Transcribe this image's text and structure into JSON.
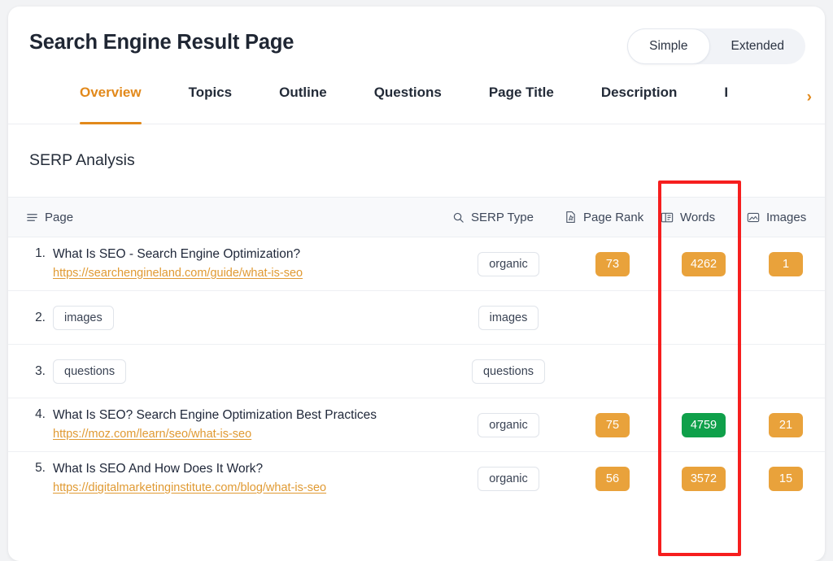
{
  "header": {
    "title": "Search Engine Result Page",
    "view_toggle": {
      "options": [
        "Simple",
        "Extended"
      ],
      "selected": "Simple"
    }
  },
  "tabs": {
    "items": [
      {
        "label": "Overview",
        "active": true
      },
      {
        "label": "Topics",
        "active": false
      },
      {
        "label": "Outline",
        "active": false
      },
      {
        "label": "Questions",
        "active": false
      },
      {
        "label": "Page Title",
        "active": false
      },
      {
        "label": "Description",
        "active": false
      },
      {
        "label": "I",
        "active": false
      }
    ],
    "next_arrow": "›"
  },
  "section": {
    "title": "SERP Analysis"
  },
  "table": {
    "columns": [
      {
        "key": "page",
        "label": "Page",
        "icon": "list-icon"
      },
      {
        "key": "serp",
        "label": "SERP Type",
        "icon": "search-icon"
      },
      {
        "key": "rank",
        "label": "Page Rank",
        "icon": "page-rank-icon"
      },
      {
        "key": "words",
        "label": "Words",
        "icon": "book-icon"
      },
      {
        "key": "images",
        "label": "Images",
        "icon": "image-icon"
      }
    ],
    "rows": [
      {
        "num": "1.",
        "kind": "link",
        "title": "What Is SEO - Search Engine Optimization?",
        "url": "https://searchengineland.com/guide/what-is-seo",
        "serp_type": "organic",
        "page_rank": "73",
        "page_rank_color": "orange",
        "words": "4262",
        "words_color": "orange",
        "images": "1",
        "images_color": "orange"
      },
      {
        "num": "2.",
        "kind": "chip",
        "chip": "images",
        "title": "",
        "url": "",
        "serp_type": "images",
        "page_rank": "",
        "page_rank_color": "",
        "words": "",
        "words_color": "",
        "images": "",
        "images_color": ""
      },
      {
        "num": "3.",
        "kind": "chip",
        "chip": "questions",
        "title": "",
        "url": "",
        "serp_type": "questions",
        "page_rank": "",
        "page_rank_color": "",
        "words": "",
        "words_color": "",
        "images": "",
        "images_color": ""
      },
      {
        "num": "4.",
        "kind": "link",
        "title": "What Is SEO? Search Engine Optimization Best Practices",
        "url": "https://moz.com/learn/seo/what-is-seo",
        "serp_type": "organic",
        "page_rank": "75",
        "page_rank_color": "orange",
        "words": "4759",
        "words_color": "green",
        "images": "21",
        "images_color": "orange"
      },
      {
        "num": "5.",
        "kind": "link",
        "title": "What Is SEO And How Does It Work?",
        "url": "https://digitalmarketinginstitute.com/blog/what-is-seo",
        "serp_type": "organic",
        "page_rank": "56",
        "page_rank_color": "orange",
        "words": "3572",
        "words_color": "orange",
        "images": "15",
        "images_color": "orange"
      }
    ]
  },
  "annotation": {
    "target_column": "Words",
    "color": "#f61e1e"
  },
  "colors": {
    "accent": "#e2891b",
    "badge_orange": "#e9a23b",
    "badge_green": "#0fa04a",
    "link": "#e09a33",
    "page_bg": "#f2f3f5",
    "header_row_bg": "#f8f9fb"
  }
}
